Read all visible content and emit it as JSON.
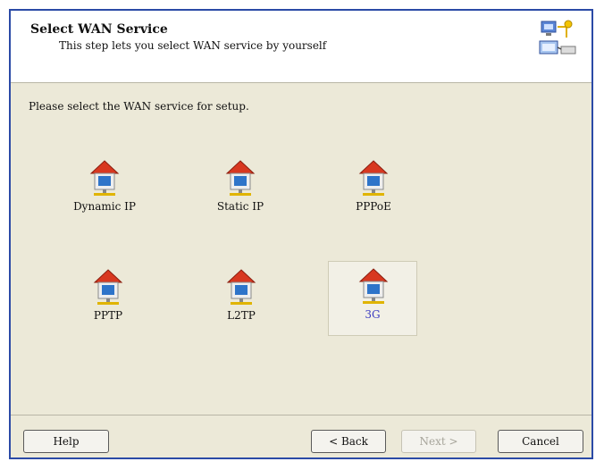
{
  "header": {
    "title": "Select WAN Service",
    "subtitle": "This step lets you select WAN service by yourself",
    "icon": "network-wizard-icon"
  },
  "prompt": "Please select the WAN service for setup.",
  "services": [
    {
      "label": "Dynamic IP",
      "icon": "house-network-icon"
    },
    {
      "label": "Static IP",
      "icon": "house-network-icon"
    },
    {
      "label": "PPPoE",
      "icon": "house-network-icon"
    },
    {
      "label": "PPTP",
      "icon": "house-network-icon"
    },
    {
      "label": "L2TP",
      "icon": "house-network-icon"
    },
    {
      "label": "3G",
      "icon": "house-network-icon",
      "selected": true
    }
  ],
  "buttons": {
    "help": "Help",
    "back": "< Back",
    "next": "Next >",
    "cancel": "Cancel"
  },
  "colors": {
    "window_border": "#2b4aa6",
    "dialog_bg": "#ece9d8",
    "selected_label": "#3c3cc0"
  }
}
